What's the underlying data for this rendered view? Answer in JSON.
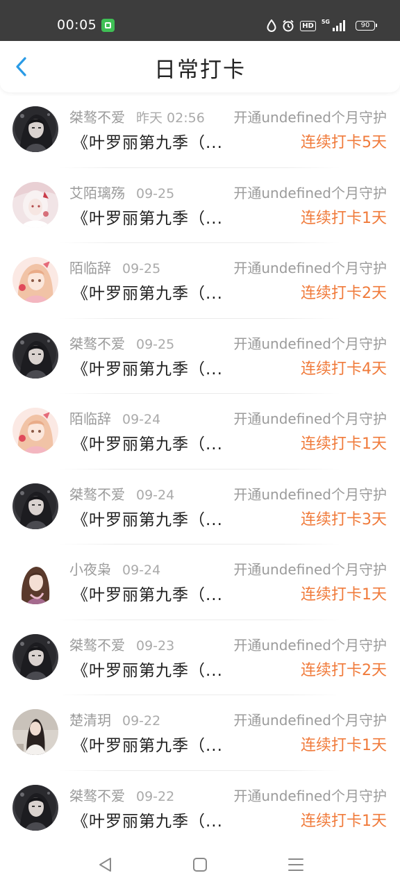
{
  "status_bar": {
    "time": "00:05",
    "hd": "HD",
    "network": "5G",
    "battery": "90"
  },
  "header": {
    "title": "日常打卡"
  },
  "colors": {
    "accent_orange": "#f07a3a",
    "back_blue": "#2a9be6",
    "muted_text": "#9b9b9b"
  },
  "records": [
    {
      "user": "桀骜不爱",
      "date": "昨天 02:56",
      "guard": "开通undefined个月守护",
      "book": "《叶罗丽第九季（...",
      "streak": "连续打卡5天",
      "avatar": "dark-hair-girl"
    },
    {
      "user": "艾陌璃殇",
      "date": "09-25",
      "guard": "开通undefined个月守护",
      "book": "《叶罗丽第九季（...",
      "streak": "连续打卡1天",
      "avatar": "white-hair-girl"
    },
    {
      "user": "陌临辞",
      "date": "09-25",
      "guard": "开通undefined个月守护",
      "book": "《叶罗丽第九季（...",
      "streak": "连续打卡2天",
      "avatar": "pink-hair-girl"
    },
    {
      "user": "桀骜不爱",
      "date": "09-25",
      "guard": "开通undefined个月守护",
      "book": "《叶罗丽第九季（...",
      "streak": "连续打卡4天",
      "avatar": "dark-hair-girl"
    },
    {
      "user": "陌临辞",
      "date": "09-24",
      "guard": "开通undefined个月守护",
      "book": "《叶罗丽第九季（...",
      "streak": "连续打卡1天",
      "avatar": "pink-hair-girl"
    },
    {
      "user": "桀骜不爱",
      "date": "09-24",
      "guard": "开通undefined个月守护",
      "book": "《叶罗丽第九季（...",
      "streak": "连续打卡3天",
      "avatar": "dark-hair-girl"
    },
    {
      "user": "小夜枭",
      "date": "09-24",
      "guard": "开通undefined个月守护",
      "book": "《叶罗丽第九季（...",
      "streak": "连续打卡1天",
      "avatar": "brown-hair-girl"
    },
    {
      "user": "桀骜不爱",
      "date": "09-23",
      "guard": "开通undefined个月守护",
      "book": "《叶罗丽第九季（...",
      "streak": "连续打卡2天",
      "avatar": "dark-hair-girl"
    },
    {
      "user": "楚清玥",
      "date": "09-22",
      "guard": "开通undefined个月守护",
      "book": "《叶罗丽第九季（...",
      "streak": "连续打卡1天",
      "avatar": "photo-girl"
    },
    {
      "user": "桀骜不爱",
      "date": "09-22",
      "guard": "开通undefined个月守护",
      "book": "《叶罗丽第九季（...",
      "streak": "连续打卡1天",
      "avatar": "dark-hair-girl"
    }
  ],
  "nav": {
    "back_icon": "triangle-back-icon",
    "home_icon": "square-home-icon",
    "menu_icon": "lines-menu-icon"
  }
}
